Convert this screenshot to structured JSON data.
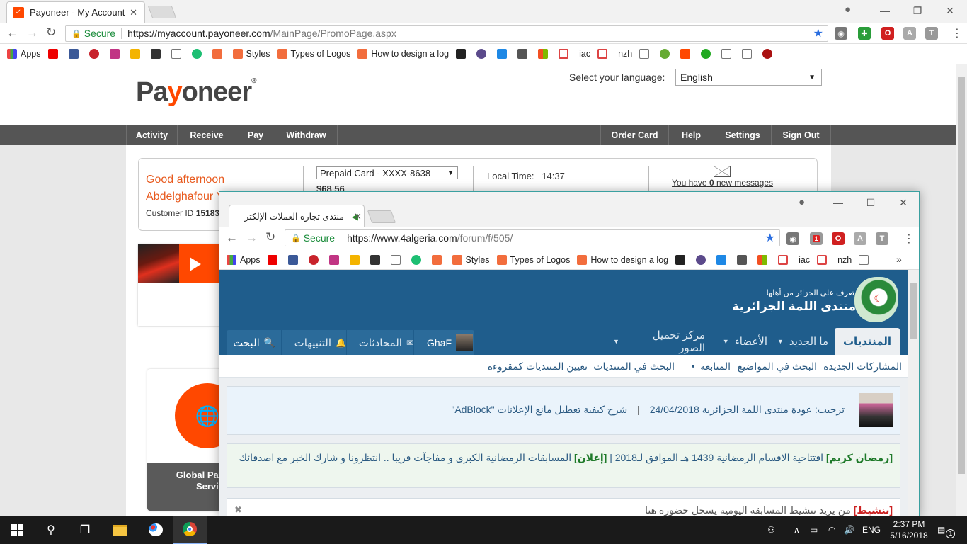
{
  "main_browser": {
    "tab_title": "Payoneer - My Account",
    "secure_label": "Secure",
    "url_host": "https://myaccount.payoneer.com",
    "url_path": "/MainPage/PromoPage.aspx",
    "bookmarks": [
      "Apps",
      "Styles",
      "Types of Logos",
      "How to design a log",
      "iac",
      "nzh"
    ]
  },
  "payoneer": {
    "logo_text": "Payoneer",
    "language_label": "Select your language:",
    "language_value": "English",
    "nav_left": [
      "Activity",
      "Receive",
      "Pay",
      "Withdraw"
    ],
    "nav_right": [
      "Order Card",
      "Help",
      "Settings",
      "Sign Out"
    ],
    "greeting_line1": "Good afternoon",
    "greeting_line2": "Abdelghafour Y",
    "customer_id_label": "Customer ID",
    "customer_id_value": "15183",
    "card_select": "Prepaid Card - XXXX-8638",
    "balance": "$68.56",
    "local_time_label": "Local Time:",
    "local_time_value": "14:37",
    "messages_prefix": "You have",
    "messages_count": "0",
    "messages_suffix": "new messages",
    "global_pay_line1": "Global Pay",
    "global_pay_line2": "Servic"
  },
  "overlay_browser": {
    "tab_title": "منتدى تجارة العملات الإلكتر",
    "secure_label": "Secure",
    "url_host": "https://www.4algeria.com",
    "url_path": "/forum/f/505/",
    "bookmarks": [
      "Apps",
      "Styles",
      "Types of Logos",
      "How to design a log",
      "iac",
      "nzh"
    ],
    "ext_badge": "1",
    "bookmarks_more": "»"
  },
  "forum": {
    "logo_tagline": "تعرف على الجزائر من أهلها",
    "logo_title": "منتدى اللمة الجزائرية",
    "nav": [
      "المنتديات",
      "ما الجديد",
      "الأعضاء",
      "مركز تحميل الصور"
    ],
    "user_name": "GhaF",
    "conversations": "المحادثات",
    "alerts": "التنبيهات",
    "search": "البحث",
    "subnav": [
      "المشاركات الجديدة",
      "البحث في المواضيع",
      "المتابعة",
      "البحث في المنتديات",
      "تعيين المنتديات كمقروءة"
    ],
    "notice1_text": "ترحيب: عودة منتدى اللمة الجزائرية 24/04/2018",
    "notice1_sep": "|",
    "notice1_link": "شرح كيفية تعطيل مانع الإعلانات \"AdBlock\"",
    "notice2_tag1": "[رمضان كريم]",
    "notice2_text1": "افتتاحية الاقسام الرمضانية 1439 هـ الموافق لـ2018 |",
    "notice2_tag2": "[إعلان]",
    "notice2_text2": "المسابقات الرمضانية الكبرى و مفاجآت قريبا .. انتظرونا و شارك الخبر مع اصدقائك",
    "notice3_tag": "[تنشيط]",
    "notice3_text": "من يريد تنشيط المسابقة اليومية يسجل حضوره هنا",
    "close_x": "✖"
  },
  "taskbar": {
    "lang": "ENG",
    "time": "2:37 PM",
    "date": "5/16/2018",
    "notif_count": "1"
  }
}
